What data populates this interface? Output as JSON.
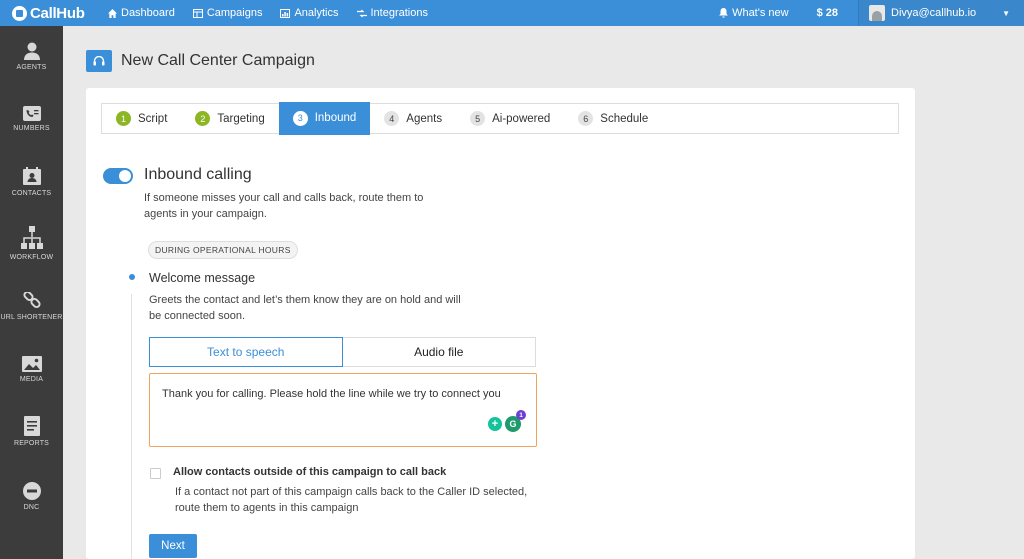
{
  "app": {
    "brand": "CallHub"
  },
  "topnav": {
    "items": [
      {
        "label": "Dashboard",
        "icon": "home-icon"
      },
      {
        "label": "Campaigns",
        "icon": "campaigns-icon"
      },
      {
        "label": "Analytics",
        "icon": "analytics-icon"
      },
      {
        "label": "Integrations",
        "icon": "integrations-icon"
      }
    ],
    "whats_new": "What's new",
    "balance": "$ 28",
    "user_email": "Divya@callhub.io"
  },
  "sidebar": {
    "items": [
      {
        "label": "AGENTS",
        "icon": "agents-icon"
      },
      {
        "label": "NUMBERS",
        "icon": "numbers-icon"
      },
      {
        "label": "CONTACTS",
        "icon": "contacts-icon"
      },
      {
        "label": "WORKFLOW",
        "icon": "workflow-icon"
      },
      {
        "label": "URL SHORTENER",
        "icon": "link-icon"
      },
      {
        "label": "MEDIA",
        "icon": "media-icon"
      },
      {
        "label": "REPORTS",
        "icon": "reports-icon"
      },
      {
        "label": "DNC",
        "icon": "dnc-icon"
      }
    ]
  },
  "page": {
    "title": "New Call Center Campaign"
  },
  "steps": [
    {
      "num": "1",
      "label": "Script",
      "state": "done"
    },
    {
      "num": "2",
      "label": "Targeting",
      "state": "done"
    },
    {
      "num": "3",
      "label": "Inbound",
      "state": "active"
    },
    {
      "num": "4",
      "label": "Agents",
      "state": "pending"
    },
    {
      "num": "5",
      "label": "Ai-powered",
      "state": "pending"
    },
    {
      "num": "6",
      "label": "Schedule",
      "state": "pending"
    }
  ],
  "inbound": {
    "enabled": true,
    "title": "Inbound calling",
    "description": "If someone misses your call and calls back, route them to agents in your campaign.",
    "hours_badge": "DURING OPERATIONAL HOURS",
    "welcome_title": "Welcome message",
    "welcome_description": "Greets the contact and let’s them know they are on hold and will be connected soon.",
    "tabs": {
      "tts": "Text to speech",
      "audio": "Audio file",
      "selected": "tts"
    },
    "tts_text": "Thank you for calling. Please hold the line while we try to connect you",
    "grammarly_count": "1",
    "allow_outside_label": "Allow contacts outside of this campaign to call back",
    "allow_outside_description": "If a contact not part of this campaign calls back to the Caller ID selected, route them to agents in this campaign",
    "allow_outside_checked": false,
    "next_label": "Next"
  },
  "colors": {
    "primary": "#3b8fd9",
    "sidebar": "#3c3c3c",
    "done_step": "#8cb623",
    "tts_border": "#f0a35e"
  }
}
